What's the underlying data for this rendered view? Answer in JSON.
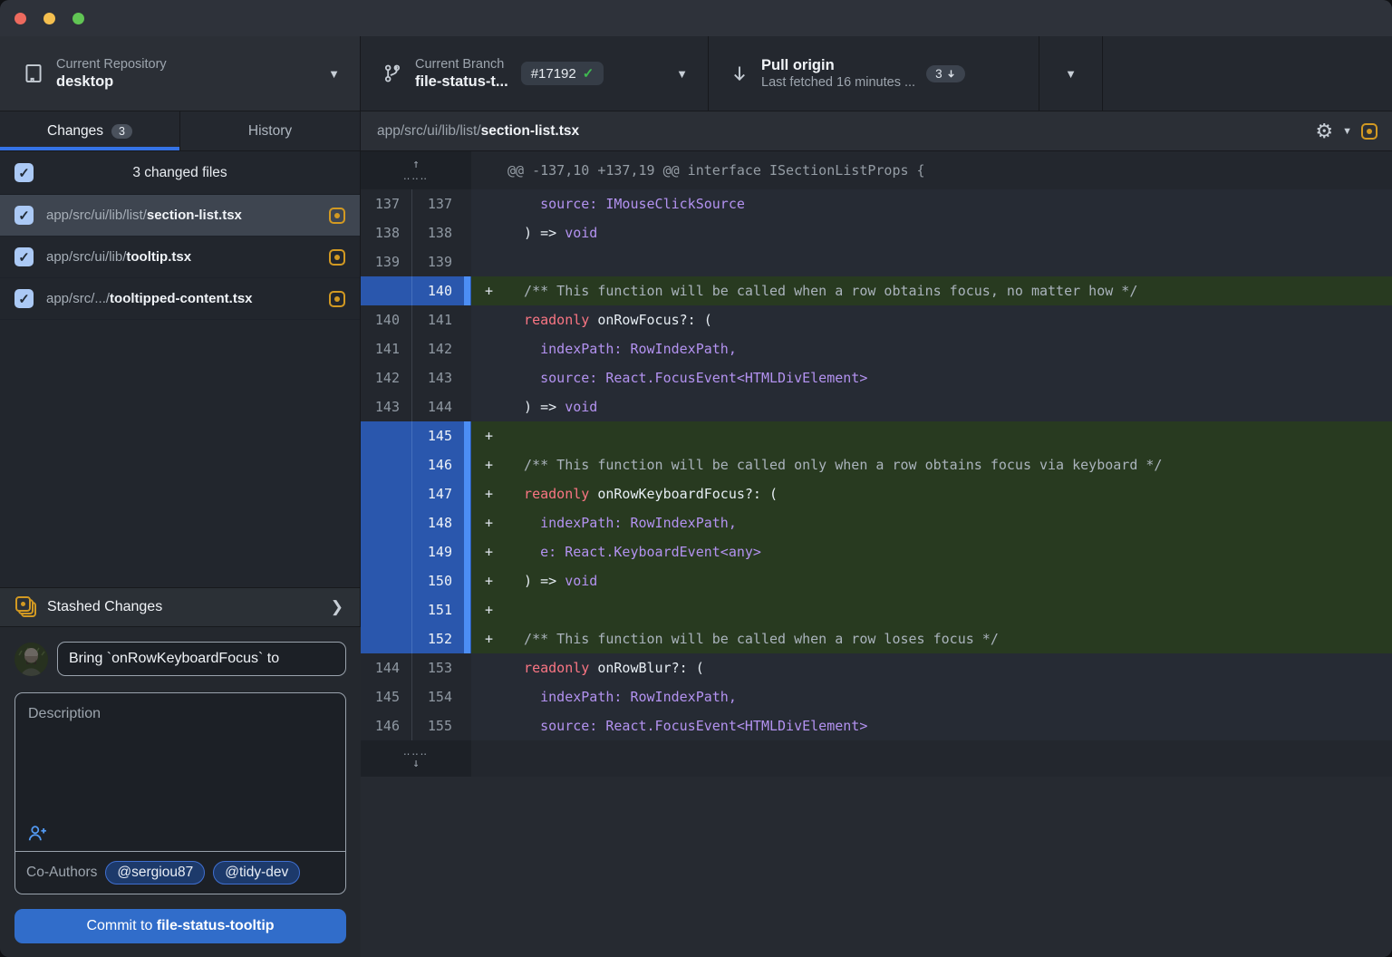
{
  "colors": {
    "accent_blue": "#316dca",
    "added_green_bg": "#283a20",
    "added_gutter_blue": "#2a57ad",
    "modified_yellow": "#d29922",
    "check_green": "#3fb950"
  },
  "toolbar": {
    "repo": {
      "label": "Current Repository",
      "value": "desktop"
    },
    "branch": {
      "label": "Current Branch",
      "value": "file-status-t...",
      "badge": "#17192"
    },
    "pull": {
      "title": "Pull origin",
      "subtitle": "Last fetched 16 minutes ...",
      "badge_count": "3"
    }
  },
  "tabs": {
    "changes": "Changes",
    "changes_count": "3",
    "history": "History"
  },
  "sidebar": {
    "header": "3 changed files",
    "files": [
      {
        "dir": "app/src/ui/lib/list/",
        "name": "section-list.tsx",
        "checked": true,
        "selected": true,
        "status": "modified"
      },
      {
        "dir": "app/src/ui/lib/",
        "name": "tooltip.tsx",
        "checked": true,
        "selected": false,
        "status": "modified"
      },
      {
        "dir": "app/src/.../",
        "name": "tooltipped-content.tsx",
        "checked": true,
        "selected": false,
        "status": "modified"
      }
    ],
    "stashed_label": "Stashed Changes"
  },
  "commit": {
    "summary_value": "Bring `onRowKeyboardFocus` to",
    "description_placeholder": "Description",
    "coauthors_label": "Co-Authors",
    "coauthors": [
      "@sergiou87",
      "@tidy-dev"
    ],
    "button_prefix": "Commit to ",
    "button_branch": "file-status-tooltip"
  },
  "diff": {
    "path_dir": "app/src/ui/lib/list/",
    "path_file": "section-list.tsx",
    "hunk_header": "@@ -137,10 +137,19 @@ interface ISectionListProps {",
    "rows": [
      {
        "old": "137",
        "new": "137",
        "type": "context",
        "segments": [
          [
            "pln",
            "    "
          ],
          [
            "pur",
            "source: IMouseClickSource"
          ]
        ]
      },
      {
        "old": "138",
        "new": "138",
        "type": "context",
        "segments": [
          [
            "pln",
            "  ) => "
          ],
          [
            "pur",
            "void"
          ]
        ]
      },
      {
        "old": "139",
        "new": "139",
        "type": "context",
        "segments": []
      },
      {
        "old": "",
        "new": "140",
        "type": "add",
        "segments": [
          [
            "com",
            "  /** This function will be called when a row obtains focus, no matter how */"
          ]
        ]
      },
      {
        "old": "140",
        "new": "141",
        "type": "context",
        "segments": [
          [
            "red",
            "  readonly"
          ],
          [
            "pln",
            " onRowFocus?: ("
          ]
        ]
      },
      {
        "old": "141",
        "new": "142",
        "type": "context",
        "segments": [
          [
            "pln",
            "    "
          ],
          [
            "pur",
            "indexPath: RowIndexPath,"
          ]
        ]
      },
      {
        "old": "142",
        "new": "143",
        "type": "context",
        "segments": [
          [
            "pln",
            "    "
          ],
          [
            "pur",
            "source: React.FocusEvent<HTMLDivElement>"
          ]
        ]
      },
      {
        "old": "143",
        "new": "144",
        "type": "context",
        "segments": [
          [
            "pln",
            "  ) => "
          ],
          [
            "pur",
            "void"
          ]
        ]
      },
      {
        "old": "",
        "new": "145",
        "type": "add",
        "segments": []
      },
      {
        "old": "",
        "new": "146",
        "type": "add",
        "segments": [
          [
            "com",
            "  /** This function will be called only when a row obtains focus via keyboard */"
          ]
        ]
      },
      {
        "old": "",
        "new": "147",
        "type": "add",
        "segments": [
          [
            "red",
            "  readonly"
          ],
          [
            "pln",
            " onRowKeyboardFocus?: ("
          ]
        ]
      },
      {
        "old": "",
        "new": "148",
        "type": "add",
        "segments": [
          [
            "pln",
            "    "
          ],
          [
            "pur",
            "indexPath: RowIndexPath,"
          ]
        ]
      },
      {
        "old": "",
        "new": "149",
        "type": "add",
        "segments": [
          [
            "pln",
            "    "
          ],
          [
            "pur",
            "e: React.KeyboardEvent<any>"
          ]
        ]
      },
      {
        "old": "",
        "new": "150",
        "type": "add",
        "segments": [
          [
            "pln",
            "  ) => "
          ],
          [
            "pur",
            "void"
          ]
        ]
      },
      {
        "old": "",
        "new": "151",
        "type": "add",
        "segments": []
      },
      {
        "old": "",
        "new": "152",
        "type": "add",
        "segments": [
          [
            "com",
            "  /** This function will be called when a row loses focus */"
          ]
        ]
      },
      {
        "old": "144",
        "new": "153",
        "type": "context",
        "segments": [
          [
            "red",
            "  readonly"
          ],
          [
            "pln",
            " onRowBlur?: ("
          ]
        ]
      },
      {
        "old": "145",
        "new": "154",
        "type": "context",
        "segments": [
          [
            "pln",
            "    "
          ],
          [
            "pur",
            "indexPath: RowIndexPath,"
          ]
        ]
      },
      {
        "old": "146",
        "new": "155",
        "type": "context",
        "segments": [
          [
            "pln",
            "    "
          ],
          [
            "pur",
            "source: React.FocusEvent<HTMLDivElement>"
          ]
        ]
      }
    ]
  }
}
